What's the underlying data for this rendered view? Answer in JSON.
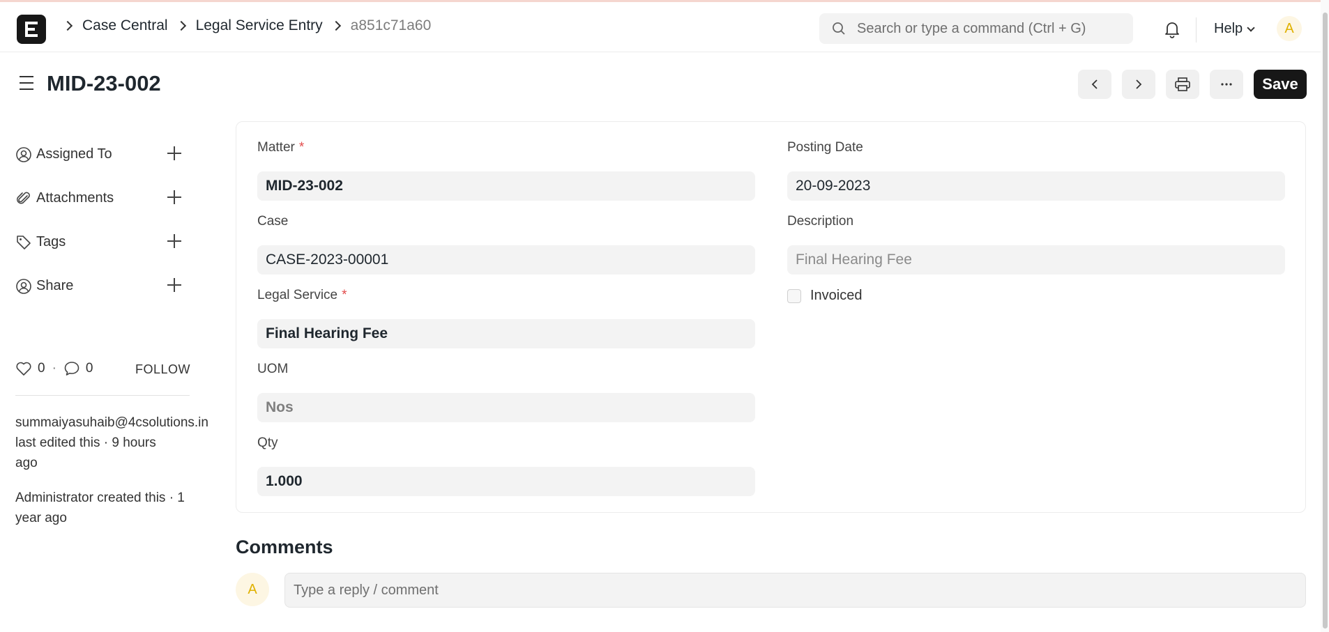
{
  "navbar": {
    "logo_letter": "E",
    "breadcrumb": [
      "Case Central",
      "Legal Service Entry",
      "a851c71a60"
    ],
    "search_placeholder": "Search or type a command (Ctrl + G)",
    "help_label": "Help",
    "avatar_initial": "A"
  },
  "page": {
    "title": "MID-23-002",
    "save_label": "Save"
  },
  "sidebar": {
    "items": [
      {
        "label": "Assigned To",
        "icon": "assign-user-icon"
      },
      {
        "label": "Attachments",
        "icon": "paperclip-icon"
      },
      {
        "label": "Tags",
        "icon": "tag-icon"
      },
      {
        "label": "Share",
        "icon": "share-user-icon"
      }
    ],
    "likes": "0",
    "comments_count": "0",
    "follow_label": "FOLLOW",
    "activity_user": "summaiyasuhaib@4csolutions.in",
    "activity_text": "last edited this · 9 hours ago",
    "created_text": "Administrator created this · 1 year ago"
  },
  "form": {
    "matter": {
      "label": "Matter",
      "value": "MID-23-002",
      "required": true
    },
    "case": {
      "label": "Case",
      "value": "CASE-2023-00001"
    },
    "legal_service": {
      "label": "Legal Service",
      "value": "Final Hearing Fee",
      "required": true
    },
    "uom": {
      "label": "UOM",
      "value": "Nos"
    },
    "qty": {
      "label": "Qty",
      "value": "1.000"
    },
    "posting_date": {
      "label": "Posting Date",
      "value": "20-09-2023"
    },
    "description": {
      "label": "Description",
      "value": "Final Hearing Fee"
    },
    "invoiced": {
      "label": "Invoiced",
      "checked": false
    }
  },
  "comments": {
    "title": "Comments",
    "avatar_initial": "A",
    "placeholder": "Type a reply / comment"
  }
}
